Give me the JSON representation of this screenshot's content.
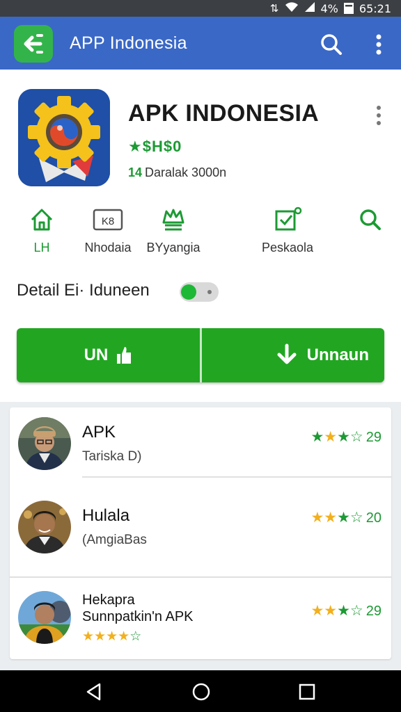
{
  "status_bar": {
    "battery": "4%",
    "time": "65:21"
  },
  "app_bar": {
    "title": "APP Indonesia"
  },
  "app": {
    "name": "APK INDONESIA",
    "rating_text": "★$H$0",
    "downloads": "Daralak 3000n",
    "downloads_mark": "14"
  },
  "tabs": [
    {
      "label": "LH",
      "icon": "home-icon"
    },
    {
      "label": "Nhodaia",
      "icon": "keyboard-icon"
    },
    {
      "label": "BYyangia",
      "icon": "crown-icon"
    },
    {
      "label": "Peskaola",
      "icon": "checkbox-icon"
    },
    {
      "label": "",
      "icon": "search-icon"
    }
  ],
  "detail": {
    "label": "Detail Ei· Iduneen"
  },
  "buttons": {
    "left_label": "UN",
    "right_label": "Unnaun"
  },
  "reviews": [
    {
      "name": "APK",
      "subtitle": "Tariska D)",
      "rating": 3.5,
      "count": "29"
    },
    {
      "name": "Hulala",
      "subtitle": "(AmgiaBas",
      "rating": 3.5,
      "count": "20"
    },
    {
      "name": "Hekapra",
      "subtitle": "Sunnpatkin'n APK",
      "rating": 3.5,
      "count": "29",
      "inline_rating": 4.5
    }
  ],
  "colors": {
    "app_bar": "#3a68c6",
    "accent_green": "#22a622",
    "star_gold": "#f2b01e"
  }
}
